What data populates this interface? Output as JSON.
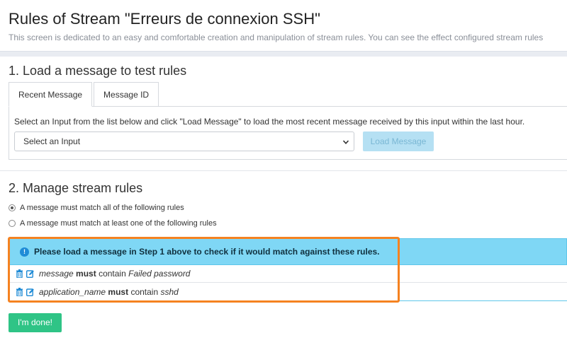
{
  "header": {
    "title": "Rules of Stream \"Erreurs de connexion SSH\"",
    "description": "This screen is dedicated to an easy and comfortable creation and manipulation of stream rules. You can see the effect configured stream rules"
  },
  "step1": {
    "title": "1. Load a message to test rules",
    "tabs": [
      {
        "label": "Recent Message",
        "active": true
      },
      {
        "label": "Message ID",
        "active": false
      }
    ],
    "help_text": "Select an Input from the list below and click \"Load Message\" to load the most recent message received by this input within the last hour.",
    "select_value": "Select an Input",
    "load_button": "Load Message"
  },
  "step2": {
    "title": "2. Manage stream rules",
    "match_options": [
      {
        "label": "A message must match all of the following rules",
        "checked": true
      },
      {
        "label": "A message must match at least one of the following rules",
        "checked": false
      }
    ],
    "alert_text": "Please load a message in Step 1 above to check if it would match against these rules.",
    "rules": [
      {
        "field": "message",
        "operator": "must",
        "verb": "contain",
        "value": "Failed password"
      },
      {
        "field": "application_name",
        "operator": "must",
        "verb": "contain",
        "value": "sshd"
      }
    ]
  },
  "done_button": "I'm done!",
  "colors": {
    "alert_bg": "#7fd7f5",
    "highlight_border": "#f58220",
    "done_button": "#2fc486",
    "load_button_disabled": "#b5e0f3",
    "icon_blue": "#1f8bd6"
  }
}
